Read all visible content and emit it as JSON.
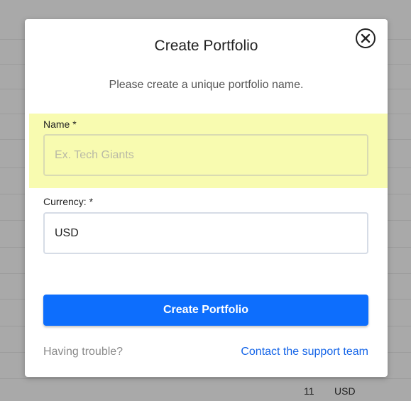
{
  "background": {
    "row_cells": [
      "11",
      "USD"
    ]
  },
  "modal": {
    "title": "Create Portfolio",
    "close_icon": "close-circle-icon",
    "subtitle": "Please create a unique portfolio name.",
    "name_field": {
      "label": "Name *",
      "value": "",
      "placeholder": "Ex. Tech Giants",
      "highlight_color": "#f8fbb0"
    },
    "currency_field": {
      "label": "Currency: *",
      "value": "USD"
    },
    "submit_label": "Create Portfolio",
    "footer": {
      "help_text": "Having trouble?",
      "support_link": "Contact the support team"
    },
    "colors": {
      "accent": "#0d6efd",
      "link": "#1565e8"
    }
  }
}
